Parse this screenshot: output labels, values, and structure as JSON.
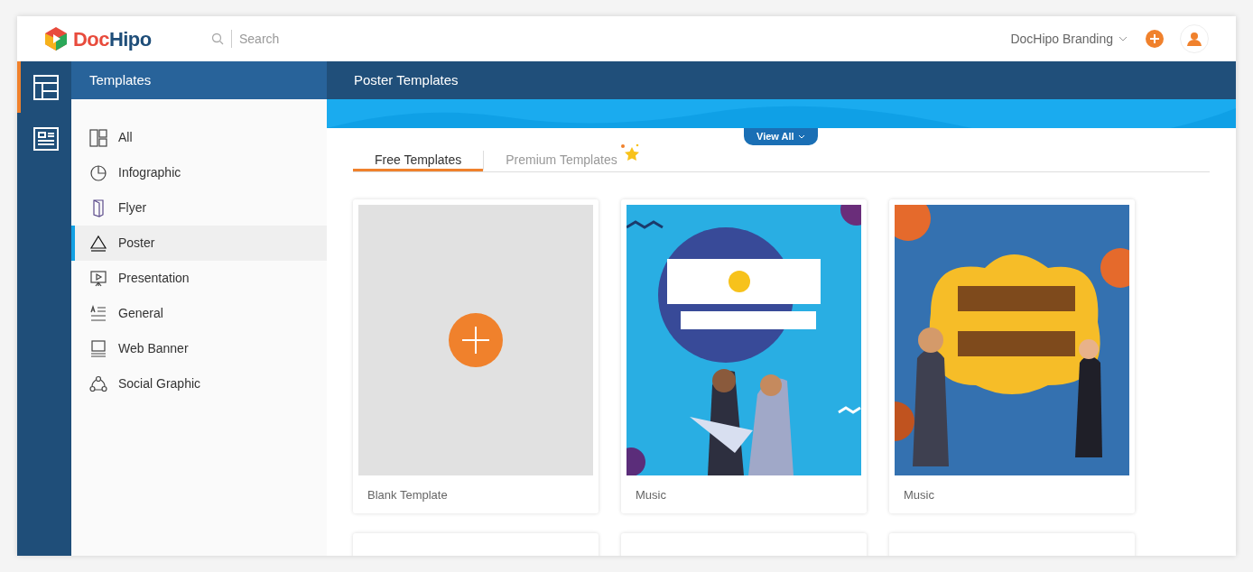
{
  "header": {
    "logo": {
      "text_left": "Doc",
      "text_right": "Hipo"
    },
    "search": {
      "placeholder": "Search"
    },
    "workspace": "DocHipo Branding"
  },
  "rail": [
    {
      "kind": "templates",
      "selected": true
    },
    {
      "kind": "documents",
      "selected": false
    }
  ],
  "sidebar": {
    "title": "Templates",
    "items": [
      {
        "kind": "all",
        "label": "All",
        "selected": false
      },
      {
        "kind": "infographic",
        "label": "Infographic",
        "selected": false
      },
      {
        "kind": "flyer",
        "label": "Flyer",
        "selected": false
      },
      {
        "kind": "poster",
        "label": "Poster",
        "selected": true
      },
      {
        "kind": "presentation",
        "label": "Presentation",
        "selected": false
      },
      {
        "kind": "general",
        "label": "General",
        "selected": false
      },
      {
        "kind": "banner",
        "label": "Web Banner",
        "selected": false
      },
      {
        "kind": "social",
        "label": "Social Graphic",
        "selected": false
      }
    ]
  },
  "main": {
    "title": "Poster Templates",
    "view_all": "View All",
    "tabs": [
      {
        "label": "Free Templates",
        "selected": true
      },
      {
        "label": "Premium Templates",
        "selected": false,
        "starred": true
      }
    ],
    "cards": [
      {
        "kind": "blank",
        "label": "Blank Template"
      },
      {
        "kind": "rock",
        "label": "Music"
      },
      {
        "kind": "college",
        "label": "Music"
      }
    ]
  }
}
